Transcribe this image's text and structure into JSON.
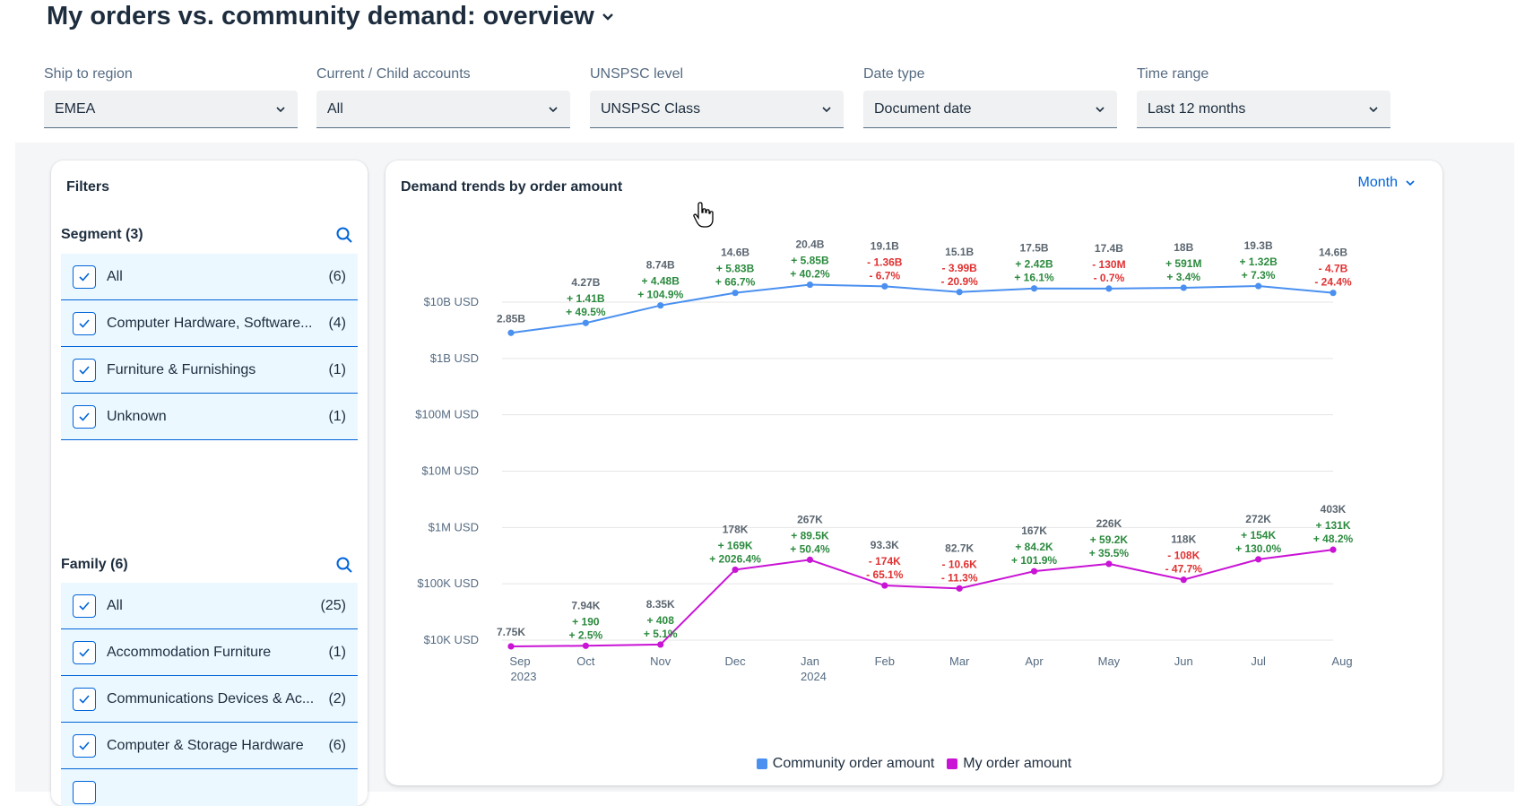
{
  "page": {
    "title": "My orders vs. community demand: overview"
  },
  "filterbar": {
    "items": [
      {
        "label": "Ship to region",
        "value": "EMEA"
      },
      {
        "label": "Current / Child accounts",
        "value": "All"
      },
      {
        "label": "UNSPSC level",
        "value": "UNSPSC Class"
      },
      {
        "label": "Date type",
        "value": "Document date"
      },
      {
        "label": "Time range",
        "value": "Last 12 months"
      }
    ]
  },
  "filters_panel": {
    "title": "Filters",
    "segment": {
      "header": "Segment (3)",
      "items": [
        {
          "label": "All",
          "count": "(6)",
          "checked": true
        },
        {
          "label": "Computer Hardware, Software...",
          "count": "(4)",
          "checked": true
        },
        {
          "label": "Furniture & Furnishings",
          "count": "(1)",
          "checked": true
        },
        {
          "label": "Unknown",
          "count": "(1)",
          "checked": true
        }
      ]
    },
    "family": {
      "header": "Family (6)",
      "items": [
        {
          "label": "All",
          "count": "(25)",
          "checked": true
        },
        {
          "label": "Accommodation Furniture",
          "count": "(1)",
          "checked": true
        },
        {
          "label": "Communications Devices & Ac...",
          "count": "(2)",
          "checked": true
        },
        {
          "label": "Computer & Storage Hardware",
          "count": "(6)",
          "checked": true
        }
      ]
    }
  },
  "chart_panel": {
    "title": "Demand trends by order amount",
    "period_button": "Month"
  },
  "chart_data": {
    "type": "line",
    "title": "Demand trends by order amount",
    "y_scale": "log",
    "ylim": [
      10000,
      10000000000
    ],
    "y_ticks": [
      {
        "value": 10000000000,
        "label": "$10B USD"
      },
      {
        "value": 1000000000,
        "label": "$1B USD"
      },
      {
        "value": 100000000,
        "label": "$100M USD"
      },
      {
        "value": 10000000,
        "label": "$10M USD"
      },
      {
        "value": 1000000,
        "label": "$1M USD"
      },
      {
        "value": 100000,
        "label": "$100K USD"
      },
      {
        "value": 10000,
        "label": "$10K USD"
      }
    ],
    "x_ticks": [
      {
        "month": "Sep",
        "year": "2023"
      },
      {
        "month": "Oct",
        "year": ""
      },
      {
        "month": "Nov",
        "year": ""
      },
      {
        "month": "Dec",
        "year": ""
      },
      {
        "month": "Jan",
        "year": "2024"
      },
      {
        "month": "Feb",
        "year": ""
      },
      {
        "month": "Mar",
        "year": ""
      },
      {
        "month": "Apr",
        "year": ""
      },
      {
        "month": "May",
        "year": ""
      },
      {
        "month": "Jun",
        "year": ""
      },
      {
        "month": "Jul",
        "year": ""
      },
      {
        "month": "Aug",
        "year": ""
      }
    ],
    "grid": true,
    "legend_position": "bottom-center",
    "series": [
      {
        "name": "Community order amount",
        "color": "#4a90f0",
        "values": [
          2850000000,
          4270000000,
          8740000000,
          14600000000,
          20400000000,
          19100000000,
          15100000000,
          17500000000,
          17400000000,
          18000000000,
          19300000000,
          14600000000
        ],
        "value_labels": [
          "2.85B",
          "4.27B",
          "8.74B",
          "14.6B",
          "20.4B",
          "19.1B",
          "15.1B",
          "17.5B",
          "17.4B",
          "18B",
          "19.3B",
          "14.6B"
        ],
        "change_labels": [
          "",
          "+ 1.41B",
          "+ 4.48B",
          "+ 5.83B",
          "+ 5.85B",
          "- 1.36B",
          "- 3.99B",
          "+ 2.42B",
          "- 130M",
          "+ 591M",
          "+ 1.32B",
          "- 4.7B"
        ],
        "pct_labels": [
          "",
          "+ 49.5%",
          "+ 104.9%",
          "+ 66.7%",
          "+ 40.2%",
          "- 6.7%",
          "- 20.9%",
          "+ 16.1%",
          "- 0.7%",
          "+ 3.4%",
          "+ 7.3%",
          "- 24.4%"
        ]
      },
      {
        "name": "My order amount",
        "color": "#c913d5",
        "values": [
          7750,
          7940,
          8350,
          178000,
          267000,
          93300,
          82700,
          167000,
          226000,
          118000,
          272000,
          403000
        ],
        "value_labels": [
          "7.75K",
          "7.94K",
          "8.35K",
          "178K",
          "267K",
          "93.3K",
          "82.7K",
          "167K",
          "226K",
          "118K",
          "272K",
          "403K"
        ],
        "change_labels": [
          "",
          "+ 190",
          "+ 408",
          "+ 169K",
          "+ 89.5K",
          "- 174K",
          "- 10.6K",
          "+ 84.2K",
          "+ 59.2K",
          "- 108K",
          "+ 154K",
          "+ 131K"
        ],
        "pct_labels": [
          "",
          "+ 2.5%",
          "+ 5.1%",
          "+ 2026.4%",
          "+ 50.4%",
          "- 65.1%",
          "- 11.3%",
          "+ 101.9%",
          "+ 35.5%",
          "- 47.7%",
          "+ 130.0%",
          "+ 48.2%"
        ]
      }
    ],
    "colors": {
      "positive": "#2b8a3e",
      "negative": "#e03131",
      "value": "#5b6670"
    }
  }
}
